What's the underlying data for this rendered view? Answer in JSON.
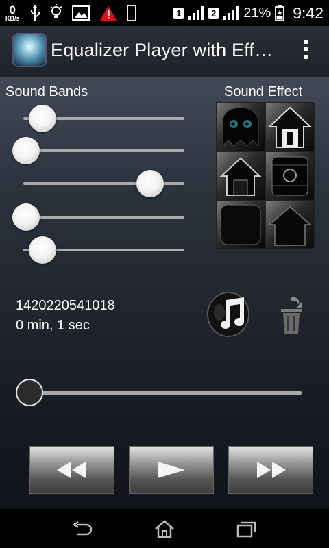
{
  "status_bar": {
    "net_speed_value": "0",
    "net_speed_unit": "KB/s",
    "sim1": "1",
    "sim2": "2",
    "battery_percent": "21%",
    "time": "9:42"
  },
  "action_bar": {
    "title": "Equalizer Player with Eff…",
    "overflow_icon": "overflow-menu-icon"
  },
  "equalizer": {
    "bands_label": "Sound Bands",
    "effect_label": "Sound Effect",
    "bands": [
      {
        "name": "band-1",
        "level": 0.11
      },
      {
        "name": "band-2",
        "level": 0.0
      },
      {
        "name": "band-3",
        "level": 0.82
      },
      {
        "name": "band-4",
        "level": 0.0
      },
      {
        "name": "band-5",
        "level": 0.11
      }
    ],
    "effects": [
      "ghost-icon",
      "house-door-icon",
      "house-outline-icon",
      "box-icon",
      "blank-tile-icon",
      "house-dark-icon"
    ]
  },
  "track": {
    "id": "1420220541018",
    "elapsed": "0 min, 1 sec",
    "progress": 0.0
  },
  "controls": {
    "rewind_icon": "rewind-icon",
    "play_icon": "play-icon",
    "forward_icon": "fast-forward-icon"
  },
  "nav": [
    "back-icon",
    "home-icon",
    "recents-icon"
  ]
}
